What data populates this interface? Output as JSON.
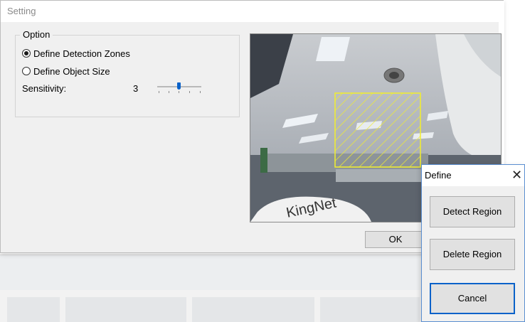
{
  "setting_window": {
    "title": "Setting",
    "option_group": {
      "legend": "Option",
      "radios": [
        {
          "label": "Define Detection Zones",
          "checked": true
        },
        {
          "label": "Define Object Size",
          "checked": false
        }
      ],
      "sensitivity": {
        "label": "Sensitivity:",
        "value": "3",
        "slider_fraction": 0.5
      }
    },
    "camera": {
      "watermark": "KingNet",
      "zone_color": "#f2ee2c"
    },
    "ok_label": "OK"
  },
  "define_dialog": {
    "title": "Define",
    "close_icon": "close-icon",
    "buttons": [
      "Detect Region",
      "Delete Region",
      "Cancel"
    ]
  },
  "colors": {
    "accent": "#0a62c9",
    "zone": "#f2ee2c"
  }
}
